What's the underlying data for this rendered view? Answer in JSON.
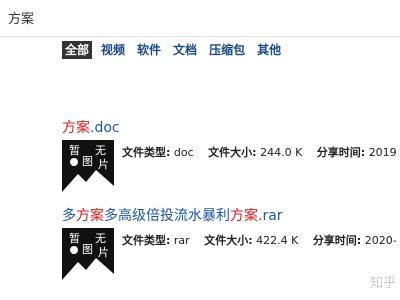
{
  "search": {
    "query": "方案"
  },
  "tabs": [
    {
      "label": "全部",
      "active": true
    },
    {
      "label": "视频",
      "active": false
    },
    {
      "label": "软件",
      "active": false
    },
    {
      "label": "文档",
      "active": false
    },
    {
      "label": "压缩包",
      "active": false
    },
    {
      "label": "其他",
      "active": false
    }
  ],
  "results": [
    {
      "title_parts": [
        "",
        "方案",
        ".doc"
      ],
      "thumb_text": [
        "暂",
        "无",
        "图",
        "片"
      ],
      "type_label": "文件类型:",
      "type_value": "doc",
      "size_label": "文件大小:",
      "size_value": "244.0 K",
      "share_label": "分享时间:",
      "share_value": "2019"
    },
    {
      "title_parts": [
        "多",
        "方案",
        "多高级倍投流水暴利",
        "方案",
        ".rar"
      ],
      "thumb_text": [
        "暂",
        "无",
        "图",
        "片"
      ],
      "type_label": "文件类型:",
      "type_value": "rar",
      "size_label": "文件大小:",
      "size_value": "422.4 K",
      "share_label": "分享时间:",
      "share_value": "2020-"
    }
  ],
  "watermark": "知乎",
  "colors": {
    "link": "#1d57a8",
    "highlight": "#d21f1f",
    "active_tab_bg": "#333333"
  }
}
